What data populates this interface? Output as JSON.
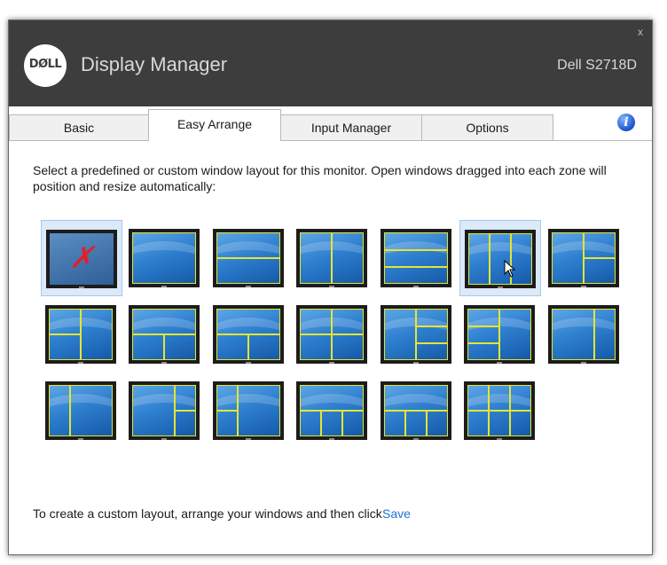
{
  "window": {
    "app_title": "Display Manager",
    "logo_text": "DØLL",
    "monitor_name": "Dell S2718D",
    "close_label": "x"
  },
  "tabs": [
    {
      "label": "Basic",
      "active": false
    },
    {
      "label": "Easy Arrange",
      "active": true
    },
    {
      "label": "Input Manager",
      "active": false
    },
    {
      "label": "Options",
      "active": false
    }
  ],
  "info_icon": {
    "glyph": "i",
    "name": "info-icon"
  },
  "description": "Select a predefined or custom window layout for this monitor.  Open windows dragged into each zone will position and resize automatically:",
  "footer": {
    "text": "To create a custom layout, arrange your windows and then click",
    "link": "Save"
  },
  "colors": {
    "titlebar": "#3d3d3d",
    "zone_border": "#e3e631",
    "highlight": "#dbe9f8",
    "link": "#1e73d6",
    "custom_x": "#e0202a"
  },
  "layouts": {
    "custom_marker": "✗",
    "selected_index": 5,
    "count": 20
  }
}
